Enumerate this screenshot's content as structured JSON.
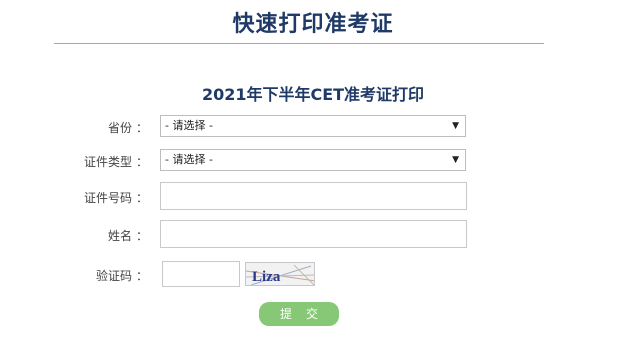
{
  "page": {
    "title": "快速打印准考证"
  },
  "form": {
    "title": "2021年下半年CET准考证打印",
    "fields": {
      "province": {
        "label": "省份",
        "colon": "：",
        "selected": "- 请选择 -"
      },
      "id_type": {
        "label": "证件类型",
        "colon": "：",
        "selected": "- 请选择 -"
      },
      "id_number": {
        "label": "证件号码",
        "colon": "：",
        "value": ""
      },
      "name": {
        "label": "姓名",
        "colon": "：",
        "value": ""
      },
      "captcha": {
        "label": "验证码",
        "colon": "：",
        "value": "",
        "image_text": "Liza"
      }
    },
    "submit_label": "提交"
  },
  "colors": {
    "title": "#1f3a66",
    "divider": "#b89ab8",
    "submit_button": "#86c876"
  },
  "icons": {
    "select_arrow": "dropdown-arrow-icon"
  }
}
